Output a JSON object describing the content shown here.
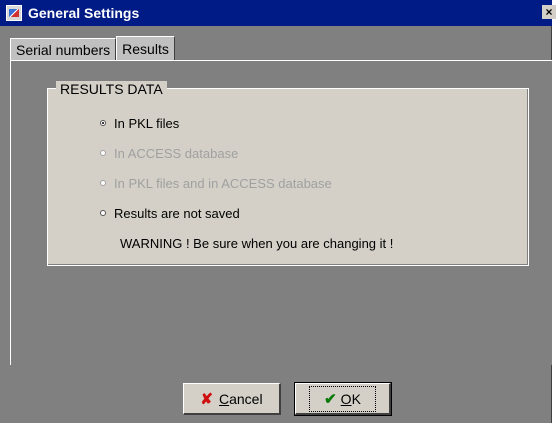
{
  "window": {
    "title": "General Settings",
    "close_label": "×"
  },
  "tabs": [
    {
      "label": "Serial numbers",
      "active": false
    },
    {
      "label": "Results",
      "active": true
    }
  ],
  "results_group": {
    "legend": "RESULTS DATA",
    "options": [
      {
        "label": "In PKL files",
        "checked": true,
        "enabled": true
      },
      {
        "label": "In ACCESS database",
        "checked": false,
        "enabled": false
      },
      {
        "label": "In PKL files and in ACCESS database",
        "checked": false,
        "enabled": false
      },
      {
        "label": "Results are not saved",
        "checked": false,
        "enabled": true
      }
    ],
    "warning": "WARNING !  Be sure when you are changing it !"
  },
  "buttons": {
    "cancel": {
      "label_first": "C",
      "label_rest": "ancel",
      "icon": "x-icon"
    },
    "ok": {
      "label_first": "O",
      "label_rest": "K",
      "icon": "check-icon"
    }
  },
  "colors": {
    "titlebar": "#001a86",
    "background": "#808080",
    "panel": "#d4d0c8"
  }
}
